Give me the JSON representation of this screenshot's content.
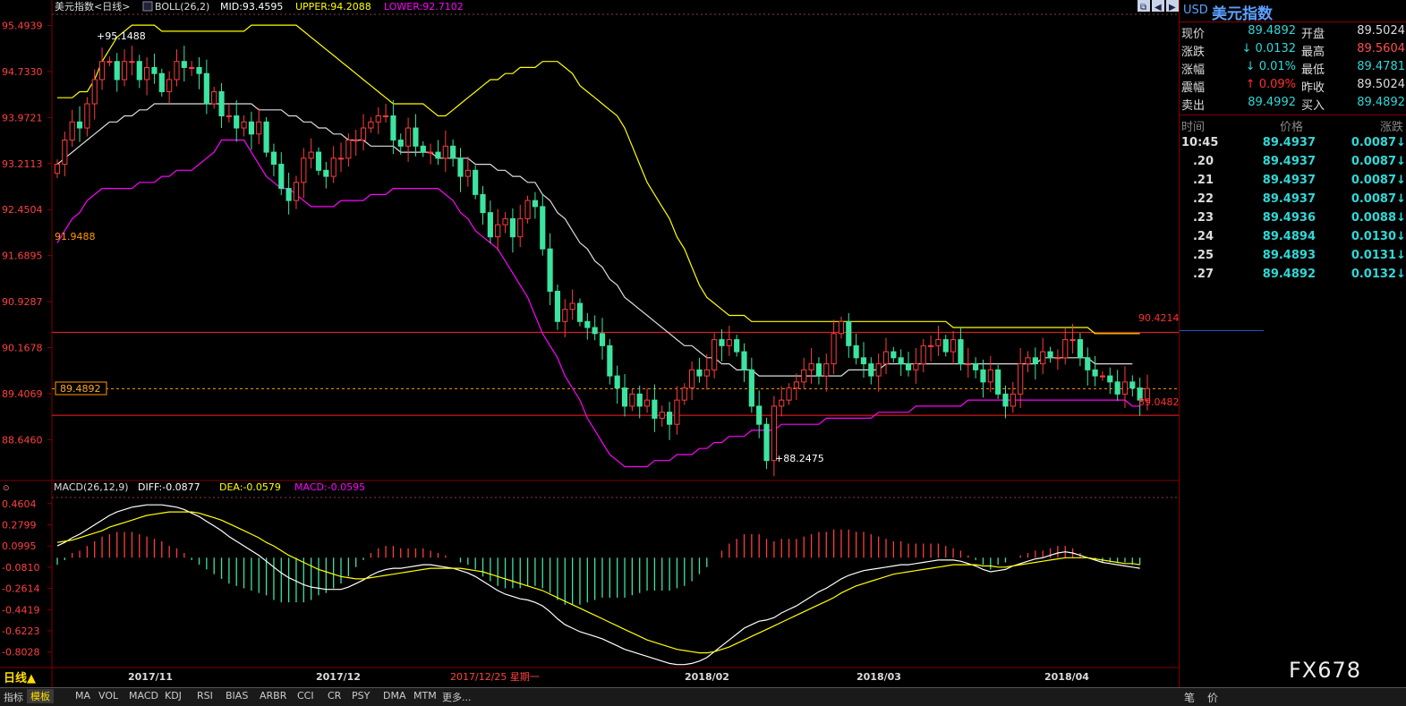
{
  "window": {
    "title": "美元指数<日线>"
  },
  "main_header": {
    "indicator_name": "BOLL(26,2)",
    "mid_label": "MID:93.4595",
    "upper_label": "UPPER:94.2088",
    "lower_label": "LOWER:92.7102",
    "title_color": "#dddddd",
    "mid_color": "#ffffff",
    "upper_color": "#ffff00",
    "lower_color": "#ff00ff"
  },
  "macd_header": {
    "name": "MACD(26,12,9)",
    "diff_label": "DIFF:-0.0877",
    "dea_label": "DEA:-0.0579",
    "macd_label": "MACD:-0.0595"
  },
  "price_axis_labels": [
    "95.4939",
    "94.7330",
    "93.9721",
    "93.2113",
    "92.4504",
    "91.6895",
    "90.9287",
    "90.1678",
    "89.4069",
    "88.6460"
  ],
  "macd_axis_labels": [
    "0.4604",
    "0.2799",
    "0.0995",
    "-0.0810",
    "-0.2614",
    "-0.4419",
    "-0.6223",
    "-0.8028"
  ],
  "annotations": {
    "high_marker": "+95.1488",
    "low_marker": "+88.2475",
    "lower_band_start": "91.9488",
    "current_price_box": "89.4892",
    "upper_line_label": "90.4214",
    "lower_line_label": "89.0482"
  },
  "date_labels": [
    "2017/11",
    "2017/12",
    "2018/02",
    "2018/03",
    "2018/04"
  ],
  "cursor_date": "2017/12/25 星期一",
  "period_label": "日线▲",
  "bottom_tabs": [
    "指标",
    "模板",
    "MA",
    "VOL",
    "MACD",
    "KDJ",
    "RSI",
    "BIAS",
    "ARBR",
    "CCI",
    "CR",
    "PSY",
    "DMA",
    "MTM",
    "更多..."
  ],
  "panel_tabs": [
    "笔",
    "价"
  ],
  "watermark": "FX678",
  "quote": {
    "code": "USD",
    "name": "美元指数",
    "rows": [
      {
        "l1": "现价",
        "v1": "89.4892",
        "l2": "开盘",
        "v2": "89.5024",
        "v2c": ""
      },
      {
        "l1": "涨跌",
        "v1": "0.0132",
        "a1": "dn",
        "l2": "最高",
        "v2": "89.5604",
        "v2c": "up"
      },
      {
        "l1": "涨幅",
        "v1": "0.01%",
        "a1": "dn",
        "l2": "最低",
        "v2": "89.4781",
        "v2c": "dn"
      },
      {
        "l1": "震幅",
        "v1": "0.09%",
        "a1": "up",
        "l2": "昨收",
        "v2": "89.5024",
        "v2c": ""
      },
      {
        "l1": "卖出",
        "v1": "89.4992",
        "l2": "买入",
        "v2": "89.4892",
        "v2c": "dn"
      }
    ],
    "ticks_header": [
      "时间",
      "价格",
      "涨跌"
    ],
    "ticks": [
      {
        "t": "10:45",
        "p": "89.4937",
        "c": "0.0087"
      },
      {
        "t": ".20",
        "p": "89.4937",
        "c": "0.0087"
      },
      {
        "t": ".21",
        "p": "89.4937",
        "c": "0.0087"
      },
      {
        "t": ".22",
        "p": "89.4937",
        "c": "0.0087"
      },
      {
        "t": ".23",
        "p": "89.4936",
        "c": "0.0088"
      },
      {
        "t": ".24",
        "p": "89.4894",
        "c": "0.0130"
      },
      {
        "t": ".25",
        "p": "89.4893",
        "c": "0.0131"
      },
      {
        "t": ".27",
        "p": "89.4892",
        "c": "0.0132"
      }
    ]
  },
  "colors": {
    "up_candle": "#ff3c3c",
    "down_candle": "#3ce4a0",
    "mid_line": "#dddddd",
    "upper_band": "#ffff00",
    "lower_band": "#ff00ff",
    "hline": "#ff2020",
    "diff_line": "#ffffff",
    "dea_line": "#ffff00",
    "macd_pos": "#ff3c3c",
    "macd_neg": "#3ce4a0"
  },
  "chart_data": [
    {
      "type": "candlestick",
      "ylim": [
        88.0,
        95.65
      ],
      "y_ticks": [
        95.4939,
        94.733,
        93.9721,
        93.2113,
        92.4504,
        91.6895,
        90.9287,
        90.1678,
        89.4069,
        88.646
      ],
      "horizontal_lines": [
        90.4214,
        89.0482
      ],
      "current_price": 89.4892,
      "close": [
        93.2,
        93.6,
        93.9,
        93.8,
        94.2,
        94.6,
        94.9,
        94.9,
        94.6,
        94.9,
        94.9,
        94.6,
        94.8,
        94.7,
        94.4,
        94.6,
        94.9,
        94.8,
        94.8,
        94.7,
        94.2,
        94.4,
        94.0,
        94.0,
        93.8,
        93.9,
        93.7,
        93.9,
        93.4,
        93.2,
        92.8,
        92.6,
        92.9,
        93.3,
        93.4,
        93.1,
        93.0,
        93.3,
        93.3,
        93.6,
        93.6,
        93.8,
        93.9,
        94.0,
        94.0,
        93.6,
        93.5,
        93.8,
        93.5,
        93.4,
        93.4,
        93.3,
        93.5,
        93.3,
        93.0,
        93.1,
        92.7,
        92.4,
        92.0,
        92.2,
        92.3,
        92.0,
        92.3,
        92.6,
        92.5,
        91.8,
        91.1,
        90.6,
        90.8,
        90.9,
        90.6,
        90.5,
        90.4,
        90.2,
        89.7,
        89.5,
        89.2,
        89.4,
        89.2,
        89.3,
        89.0,
        89.1,
        88.9,
        89.3,
        89.5,
        89.8,
        89.7,
        89.8,
        90.3,
        90.2,
        90.3,
        90.1,
        89.8,
        89.2,
        88.9,
        88.3,
        89.2,
        89.3,
        89.5,
        89.6,
        89.8,
        89.9,
        89.7,
        89.9,
        90.4,
        90.6,
        90.2,
        90.0,
        89.9,
        89.7,
        89.9,
        90.1,
        90.0,
        89.9,
        89.8,
        89.9,
        90.2,
        90.2,
        90.3,
        90.1,
        90.3,
        89.9,
        89.9,
        89.8,
        89.6,
        89.8,
        89.4,
        89.2,
        89.4,
        89.9,
        90.0,
        89.9,
        90.1,
        90.0,
        90.0,
        90.3,
        90.3,
        90.0,
        89.8,
        89.7,
        89.7,
        89.6,
        89.4,
        89.6,
        89.5,
        89.3,
        89.49
      ],
      "upper_band": [
        94.3,
        94.3,
        94.3,
        94.4,
        94.4,
        94.6,
        94.9,
        95.1,
        95.3,
        95.4,
        95.5,
        95.5,
        95.5,
        95.5,
        95.4,
        95.4,
        95.4,
        95.4,
        95.4,
        95.4,
        95.4,
        95.4,
        95.4,
        95.4,
        95.4,
        95.4,
        95.5,
        95.5,
        95.5,
        95.5,
        95.5,
        95.5,
        95.5,
        95.4,
        95.3,
        95.2,
        95.1,
        95.0,
        94.9,
        94.8,
        94.7,
        94.6,
        94.5,
        94.4,
        94.3,
        94.2,
        94.2,
        94.2,
        94.2,
        94.2,
        94.1,
        94.0,
        94.0,
        94.1,
        94.2,
        94.3,
        94.4,
        94.5,
        94.6,
        94.6,
        94.7,
        94.7,
        94.8,
        94.8,
        94.8,
        94.9,
        94.9,
        94.9,
        94.8,
        94.7,
        94.5,
        94.4,
        94.3,
        94.2,
        94.1,
        94.0,
        93.8,
        93.5,
        93.2,
        92.9,
        92.7,
        92.5,
        92.3,
        92.0,
        91.8,
        91.5,
        91.2,
        91.0,
        90.9,
        90.8,
        90.7,
        90.7,
        90.7,
        90.6,
        90.6,
        90.6,
        90.6,
        90.6,
        90.6,
        90.6,
        90.6,
        90.6,
        90.6,
        90.6,
        90.6,
        90.6,
        90.6,
        90.6,
        90.6,
        90.6,
        90.6,
        90.6,
        90.6,
        90.6,
        90.6,
        90.6,
        90.6,
        90.6,
        90.6,
        90.6,
        90.5,
        90.5,
        90.5,
        90.5,
        90.5,
        90.5,
        90.5,
        90.5,
        90.5,
        90.5,
        90.5,
        90.5,
        90.5,
        90.5,
        90.5,
        90.5,
        90.5,
        90.5,
        90.5,
        90.4,
        90.4,
        90.4,
        90.4,
        90.4,
        90.4,
        90.4
      ],
      "mid_band": [
        93.2,
        93.3,
        93.4,
        93.5,
        93.6,
        93.7,
        93.8,
        93.9,
        93.9,
        94.0,
        94.0,
        94.1,
        94.1,
        94.2,
        94.2,
        94.2,
        94.2,
        94.2,
        94.2,
        94.2,
        94.2,
        94.2,
        94.2,
        94.2,
        94.2,
        94.2,
        94.2,
        94.1,
        94.1,
        94.1,
        94.1,
        94.0,
        94.0,
        93.9,
        93.9,
        93.8,
        93.8,
        93.7,
        93.7,
        93.6,
        93.6,
        93.6,
        93.5,
        93.5,
        93.5,
        93.5,
        93.4,
        93.4,
        93.4,
        93.4,
        93.4,
        93.3,
        93.3,
        93.3,
        93.3,
        93.3,
        93.2,
        93.2,
        93.2,
        93.1,
        93.1,
        93.0,
        93.0,
        92.9,
        92.9,
        92.7,
        92.6,
        92.4,
        92.3,
        92.1,
        91.9,
        91.8,
        91.6,
        91.5,
        91.3,
        91.2,
        91.0,
        90.9,
        90.8,
        90.7,
        90.6,
        90.5,
        90.4,
        90.3,
        90.2,
        90.2,
        90.1,
        90.0,
        90.0,
        89.9,
        89.9,
        89.8,
        89.8,
        89.8,
        89.7,
        89.7,
        89.7,
        89.7,
        89.7,
        89.7,
        89.7,
        89.7,
        89.7,
        89.7,
        89.7,
        89.7,
        89.8,
        89.8,
        89.8,
        89.8,
        89.8,
        89.9,
        89.9,
        89.9,
        89.9,
        89.9,
        89.9,
        89.9,
        89.9,
        89.9,
        89.9,
        89.9,
        89.9,
        89.9,
        89.9,
        89.9,
        89.9,
        89.9,
        89.9,
        89.9,
        89.9,
        89.9,
        90.0,
        90.0,
        90.0,
        90.0,
        90.0,
        90.0,
        90.0,
        89.9,
        89.9,
        89.9,
        89.9,
        89.9,
        89.9
      ],
      "lower_band": [
        91.9,
        92.1,
        92.3,
        92.4,
        92.6,
        92.7,
        92.8,
        92.8,
        92.8,
        92.8,
        92.8,
        92.9,
        92.9,
        92.9,
        93.0,
        93.0,
        93.1,
        93.1,
        93.1,
        93.2,
        93.3,
        93.4,
        93.6,
        93.6,
        93.6,
        93.6,
        93.4,
        93.2,
        93.0,
        92.9,
        92.8,
        92.8,
        92.7,
        92.6,
        92.5,
        92.5,
        92.5,
        92.5,
        92.6,
        92.6,
        92.6,
        92.6,
        92.7,
        92.7,
        92.7,
        92.8,
        92.8,
        92.8,
        92.8,
        92.8,
        92.8,
        92.8,
        92.7,
        92.6,
        92.4,
        92.3,
        92.1,
        92.0,
        91.9,
        91.8,
        91.6,
        91.4,
        91.2,
        91.0,
        90.7,
        90.4,
        90.2,
        90.0,
        89.7,
        89.5,
        89.3,
        89.0,
        88.8,
        88.6,
        88.4,
        88.3,
        88.2,
        88.2,
        88.2,
        88.2,
        88.3,
        88.3,
        88.3,
        88.4,
        88.4,
        88.4,
        88.5,
        88.5,
        88.6,
        88.6,
        88.7,
        88.7,
        88.7,
        88.8,
        88.8,
        88.8,
        88.8,
        88.9,
        88.9,
        88.9,
        88.9,
        88.9,
        88.9,
        89.0,
        89.0,
        89.0,
        89.0,
        89.0,
        89.0,
        89.0,
        89.1,
        89.1,
        89.1,
        89.1,
        89.1,
        89.2,
        89.2,
        89.2,
        89.2,
        89.2,
        89.2,
        89.2,
        89.3,
        89.3,
        89.3,
        89.3,
        89.3,
        89.3,
        89.3,
        89.3,
        89.3,
        89.3,
        89.3,
        89.3,
        89.3,
        89.3,
        89.3,
        89.3,
        89.3,
        89.3,
        89.3,
        89.3,
        89.3,
        89.3,
        89.2,
        89.2
      ]
    },
    {
      "type": "macd",
      "ylim": [
        -0.95,
        0.52
      ],
      "y_ticks": [
        0.4604,
        0.2799,
        0.0995,
        -0.081,
        -0.2614,
        -0.4419,
        -0.6223,
        -0.8028
      ],
      "diff": [
        0.1,
        0.13,
        0.17,
        0.2,
        0.24,
        0.28,
        0.32,
        0.36,
        0.39,
        0.41,
        0.43,
        0.44,
        0.45,
        0.45,
        0.45,
        0.44,
        0.43,
        0.41,
        0.38,
        0.35,
        0.31,
        0.27,
        0.23,
        0.18,
        0.14,
        0.1,
        0.06,
        0.02,
        -0.03,
        -0.08,
        -0.13,
        -0.17,
        -0.2,
        -0.23,
        -0.25,
        -0.26,
        -0.27,
        -0.27,
        -0.27,
        -0.25,
        -0.22,
        -0.19,
        -0.15,
        -0.12,
        -0.1,
        -0.09,
        -0.09,
        -0.08,
        -0.07,
        -0.06,
        -0.06,
        -0.07,
        -0.08,
        -0.09,
        -0.11,
        -0.13,
        -0.16,
        -0.2,
        -0.24,
        -0.28,
        -0.31,
        -0.33,
        -0.35,
        -0.36,
        -0.38,
        -0.41,
        -0.46,
        -0.52,
        -0.57,
        -0.6,
        -0.63,
        -0.65,
        -0.67,
        -0.69,
        -0.72,
        -0.75,
        -0.78,
        -0.8,
        -0.82,
        -0.84,
        -0.86,
        -0.88,
        -0.9,
        -0.91,
        -0.91,
        -0.9,
        -0.88,
        -0.85,
        -0.8,
        -0.75,
        -0.7,
        -0.65,
        -0.6,
        -0.57,
        -0.54,
        -0.53,
        -0.51,
        -0.47,
        -0.44,
        -0.41,
        -0.37,
        -0.33,
        -0.29,
        -0.26,
        -0.22,
        -0.18,
        -0.15,
        -0.13,
        -0.11,
        -0.1,
        -0.09,
        -0.08,
        -0.07,
        -0.06,
        -0.06,
        -0.05,
        -0.04,
        -0.03,
        -0.02,
        -0.02,
        -0.02,
        -0.03,
        -0.05,
        -0.07,
        -0.1,
        -0.12,
        -0.11,
        -0.1,
        -0.07,
        -0.05,
        -0.03,
        -0.01,
        0.0,
        0.02,
        0.04,
        0.05,
        0.04,
        0.02,
        0.0,
        -0.02,
        -0.04,
        -0.05,
        -0.06,
        -0.07,
        -0.08,
        -0.09
      ],
      "dea": [
        0.13,
        0.14,
        0.15,
        0.17,
        0.19,
        0.21,
        0.23,
        0.26,
        0.28,
        0.3,
        0.32,
        0.34,
        0.36,
        0.37,
        0.38,
        0.39,
        0.39,
        0.39,
        0.39,
        0.38,
        0.36,
        0.34,
        0.32,
        0.29,
        0.26,
        0.23,
        0.2,
        0.17,
        0.13,
        0.1,
        0.06,
        0.02,
        -0.01,
        -0.04,
        -0.07,
        -0.1,
        -0.12,
        -0.14,
        -0.16,
        -0.17,
        -0.18,
        -0.18,
        -0.17,
        -0.16,
        -0.15,
        -0.14,
        -0.13,
        -0.12,
        -0.11,
        -0.1,
        -0.09,
        -0.09,
        -0.09,
        -0.09,
        -0.09,
        -0.1,
        -0.11,
        -0.12,
        -0.14,
        -0.16,
        -0.18,
        -0.2,
        -0.22,
        -0.24,
        -0.26,
        -0.28,
        -0.31,
        -0.34,
        -0.37,
        -0.4,
        -0.43,
        -0.46,
        -0.49,
        -0.52,
        -0.55,
        -0.58,
        -0.61,
        -0.64,
        -0.67,
        -0.7,
        -0.72,
        -0.74,
        -0.76,
        -0.78,
        -0.79,
        -0.8,
        -0.81,
        -0.81,
        -0.8,
        -0.78,
        -0.76,
        -0.73,
        -0.7,
        -0.67,
        -0.64,
        -0.61,
        -0.58,
        -0.55,
        -0.52,
        -0.49,
        -0.46,
        -0.43,
        -0.4,
        -0.37,
        -0.34,
        -0.3,
        -0.27,
        -0.24,
        -0.22,
        -0.2,
        -0.18,
        -0.16,
        -0.14,
        -0.13,
        -0.12,
        -0.11,
        -0.1,
        -0.09,
        -0.08,
        -0.07,
        -0.06,
        -0.06,
        -0.06,
        -0.06,
        -0.07,
        -0.07,
        -0.08,
        -0.08,
        -0.07,
        -0.06,
        -0.05,
        -0.04,
        -0.03,
        -0.02,
        -0.01,
        0.0,
        0.0,
        0.0,
        0.0,
        -0.01,
        -0.02,
        -0.03,
        -0.04,
        -0.05,
        -0.05,
        -0.06
      ]
    }
  ]
}
